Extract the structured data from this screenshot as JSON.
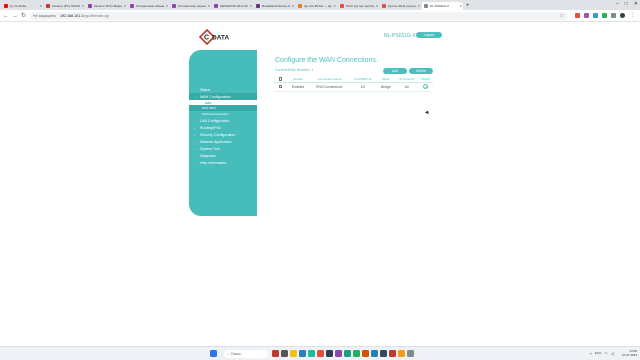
{
  "browser": {
    "tabs": [
      {
        "label": "(1) YouTube",
        "color": "#ff0000",
        "active": false
      },
      {
        "label": "Каталог (РС) TRASS Т...",
        "color": "#c0392b",
        "active": false
      },
      {
        "label": "Каталог Wi-Fi Маршру...",
        "color": "#8e44ad",
        "active": false
      },
      {
        "label": "Оптоволокно абонента...",
        "color": "#8e44ad",
        "active": false
      },
      {
        "label": "Оптоволокно перекл...",
        "color": "#8e44ad",
        "active": false
      },
      {
        "label": "GE/GEPON Wi-Fi Router...",
        "color": "#8e44ad",
        "active": false
      },
      {
        "label": "Broadband Device Ac...",
        "color": "#6c3483",
        "active": false
      },
      {
        "label": "Igr ontv lift link — Ну...",
        "color": "#e67e22",
        "active": false
      },
      {
        "label": "Wi-Fi роутер проблем...",
        "color": "#e74c3c",
        "active": false
      },
      {
        "label": "Купить Wi-Fi роутер...",
        "color": "#e74c3c",
        "active": false
      },
      {
        "label": "NL-PS011G-X",
        "color": "#7f8c8d",
        "active": true
      }
    ],
    "new_tab": "+",
    "window_controls": [
      "–",
      "□",
      "✕"
    ],
    "back": "←",
    "forward": "→",
    "reload": "↻",
    "security_label": "Не защищено",
    "host": "192.168.101.1",
    "path": "/cgi-bin/main.cgi",
    "bookmark_icon": "star-icon"
  },
  "header": {
    "logo_text": "C-DATA",
    "model": "NL-PS011G-X",
    "logout": "Logout"
  },
  "sidebar": {
    "items": [
      {
        "label": "Status",
        "arrow": "›"
      },
      {
        "label": "WAN Configuration",
        "arrow": "⌄",
        "open": true
      },
      {
        "label": "LAN Configuration",
        "arrow": "›"
      },
      {
        "label": "Routing/IPv6",
        "arrow": "›"
      },
      {
        "label": "Security Configuration",
        "arrow": "›"
      },
      {
        "label": "Network Application",
        "arrow": "›"
      },
      {
        "label": "System Tool",
        "arrow": "›"
      },
      {
        "label": "Diagnosis",
        "arrow": "›"
      },
      {
        "label": "Help Information",
        "arrow": "›"
      }
    ],
    "wan_sub": [
      {
        "label": "WAN"
      },
      {
        "label": "IPv4 WAN"
      },
      {
        "label": "WAN Authentication"
      }
    ]
  },
  "main": {
    "title": "Configure the WAN Connections.",
    "count": "Current Entry Number: 1",
    "add_button": "Add",
    "delete_button": "Delete",
    "columns": [
      "",
      "Enable",
      "Connection Name",
      "VLAN/802.1p",
      "Mode",
      "IP Protocol",
      "Modify"
    ],
    "rows": [
      {
        "enable": "Enabled",
        "name": "IPoEConnection1",
        "vlan": "1/0",
        "mode": "Bridge",
        "protocol": "All"
      }
    ]
  },
  "taskbar": {
    "search_placeholder": "Поиск",
    "time": "13:06",
    "date": "10.07.2024",
    "lang": "ENG"
  }
}
